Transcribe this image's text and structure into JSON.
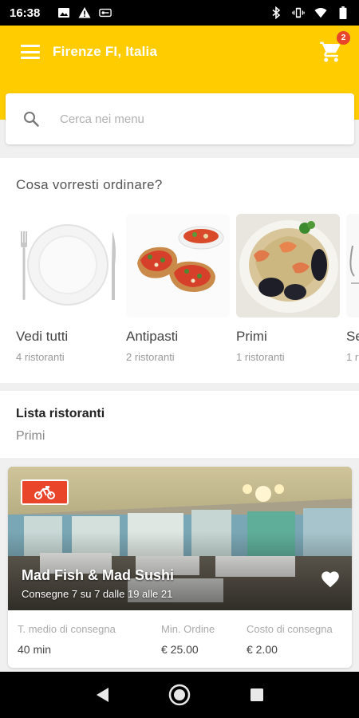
{
  "status_bar": {
    "time": "16:38",
    "left_icons": [
      "image-icon",
      "warning-icon",
      "vpn-key-icon"
    ],
    "right_icons": [
      "bluetooth-icon",
      "vibrate-icon",
      "wifi-icon",
      "battery-icon"
    ]
  },
  "app_bar": {
    "location": "Firenze FI, Italia",
    "cart_count": "2",
    "accent_color": "#ffcc00",
    "badge_color": "#e8452b"
  },
  "search": {
    "placeholder": "Cerca nei menu"
  },
  "categories": {
    "heading": "Cosa vorresti ordinare?",
    "items": [
      {
        "name": "Vedi tutti",
        "count": "4 ristoranti",
        "icon": "plate-icon"
      },
      {
        "name": "Antipasti",
        "count": "2 ristoranti",
        "icon": "bruschetta-photo"
      },
      {
        "name": "Primi",
        "count": "1 ristoranti",
        "icon": "seafood-pasta-photo"
      },
      {
        "name": "Se",
        "count": "1 r",
        "icon": "partial-category-photo"
      }
    ]
  },
  "restaurants": {
    "title": "Lista ristoranti",
    "filter": "Primi",
    "items": [
      {
        "name": "Mad Fish & Mad Sushi",
        "hours": "Consegne 7 su 7 dalle 19 alle 21",
        "delivery_time_label": "T. medio di consegna",
        "delivery_time": "40 min",
        "min_order_label": "Min. Ordine",
        "min_order": "€ 25.00",
        "delivery_cost_label": "Costo di consegna",
        "delivery_cost": "€ 2.00"
      }
    ]
  },
  "nav": {
    "icons": [
      "back-icon",
      "home-icon",
      "recents-icon"
    ]
  }
}
